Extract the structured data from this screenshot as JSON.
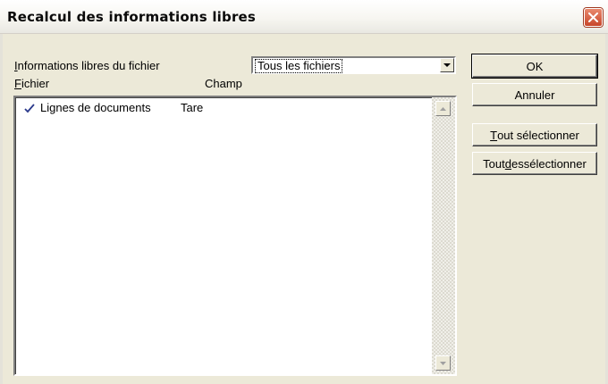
{
  "window": {
    "title": "Recalcul des informations libres"
  },
  "filter": {
    "label": "Informations libres du fichier",
    "selected": "Tous les fichiers"
  },
  "list": {
    "columns": [
      "Fichier",
      "Champ"
    ],
    "rows": [
      {
        "file": "Lignes de documents",
        "field": "Tare",
        "checked": true
      }
    ]
  },
  "buttons": {
    "ok": "OK",
    "cancel": "Annuler",
    "select_all": "Tout sélectionner",
    "deselect_all": "Tout dessélectionner"
  }
}
